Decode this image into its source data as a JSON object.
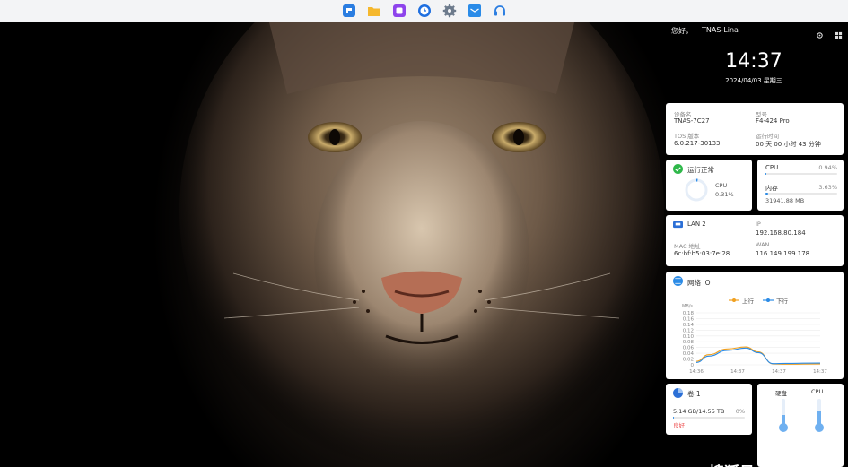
{
  "dock": {
    "items": [
      {
        "name": "file-station-icon",
        "color": "#2a7de1"
      },
      {
        "name": "folder-icon",
        "color": "#f5b82e"
      },
      {
        "name": "media-app-icon",
        "color": "#8e44ec"
      },
      {
        "name": "backup-clock-icon",
        "color": "#1f6fe0"
      },
      {
        "name": "settings-gear-icon",
        "color": "#6c7a8c"
      },
      {
        "name": "mail-icon",
        "color": "#2a8be8"
      },
      {
        "name": "support-headset-icon",
        "color": "#2a7de1"
      }
    ]
  },
  "header": {
    "greeting": "您好，",
    "username": "TNAS-Lina"
  },
  "clock": {
    "time": "14:37",
    "date": "2024/04/03 星期三"
  },
  "system": {
    "device_label": "设备名",
    "device_value": "TNAS-7C27",
    "model_label": "型号",
    "model_value": "F4-424 Pro",
    "os_label": "TOS 版本",
    "os_value": "6.0.217-30133",
    "uptime_label": "运行时间",
    "uptime_value": "00 天 00 小时 43 分钟"
  },
  "status": {
    "title": "运行正常",
    "cpu_name": "CPU",
    "cpu_value": "0.31%",
    "cpu_ring_percent": 0.31
  },
  "resources": {
    "cpu_label": "CPU",
    "cpu_percent": "0.94%",
    "cpu_fill": 0.94,
    "mem_label": "内存",
    "mem_percent": "3.63%",
    "mem_fill": 3.63,
    "mem_detail": "31941.88 MB"
  },
  "network": {
    "interface": "LAN 2",
    "ip_label": "IP",
    "ip_value": "192.168.80.184",
    "mac_label": "MAC 地址",
    "mac_value": "6c:bf:b5:03:7e:28",
    "wan_label": "WAN",
    "wan_value": "116.149.199.178"
  },
  "netio": {
    "title": "网络 IO",
    "legend_up": "上行",
    "legend_down": "下行",
    "unit": "MB/s",
    "colors": {
      "up": "#f0a020",
      "down": "#2b8be6"
    }
  },
  "chart_data": {
    "type": "line",
    "title": "网络 IO",
    "ylabel": "MB/s",
    "x": [
      "14:36",
      "14:37",
      "14:37",
      "14:37"
    ],
    "yticks": [
      "0",
      "0.02",
      "0.04",
      "0.06",
      "0.08",
      "0.10",
      "0.12",
      "0.14",
      "0.16",
      "0.18"
    ],
    "ylim": [
      0,
      0.18
    ],
    "series": [
      {
        "name": "上行",
        "x": [
          0,
          0.1,
          0.25,
          0.4,
          0.5,
          0.62,
          0.72,
          1
        ],
        "y": [
          0.012,
          0.035,
          0.055,
          0.062,
          0.045,
          0.003,
          0.002,
          0.003
        ]
      },
      {
        "name": "下行",
        "x": [
          0,
          0.1,
          0.25,
          0.4,
          0.5,
          0.62,
          0.72,
          1
        ],
        "y": [
          0.008,
          0.03,
          0.05,
          0.058,
          0.042,
          0.004,
          0.005,
          0.006
        ]
      }
    ],
    "grid": true,
    "legend": "top-center"
  },
  "storage": {
    "title": "卷 1",
    "usage": "5.14 GB/14.55 TB",
    "percent": "0%",
    "status": "良好"
  },
  "temperature": {
    "disk_label": "硬盘",
    "cpu_label": "CPU"
  },
  "watermark": "搜狐号@硬核君"
}
